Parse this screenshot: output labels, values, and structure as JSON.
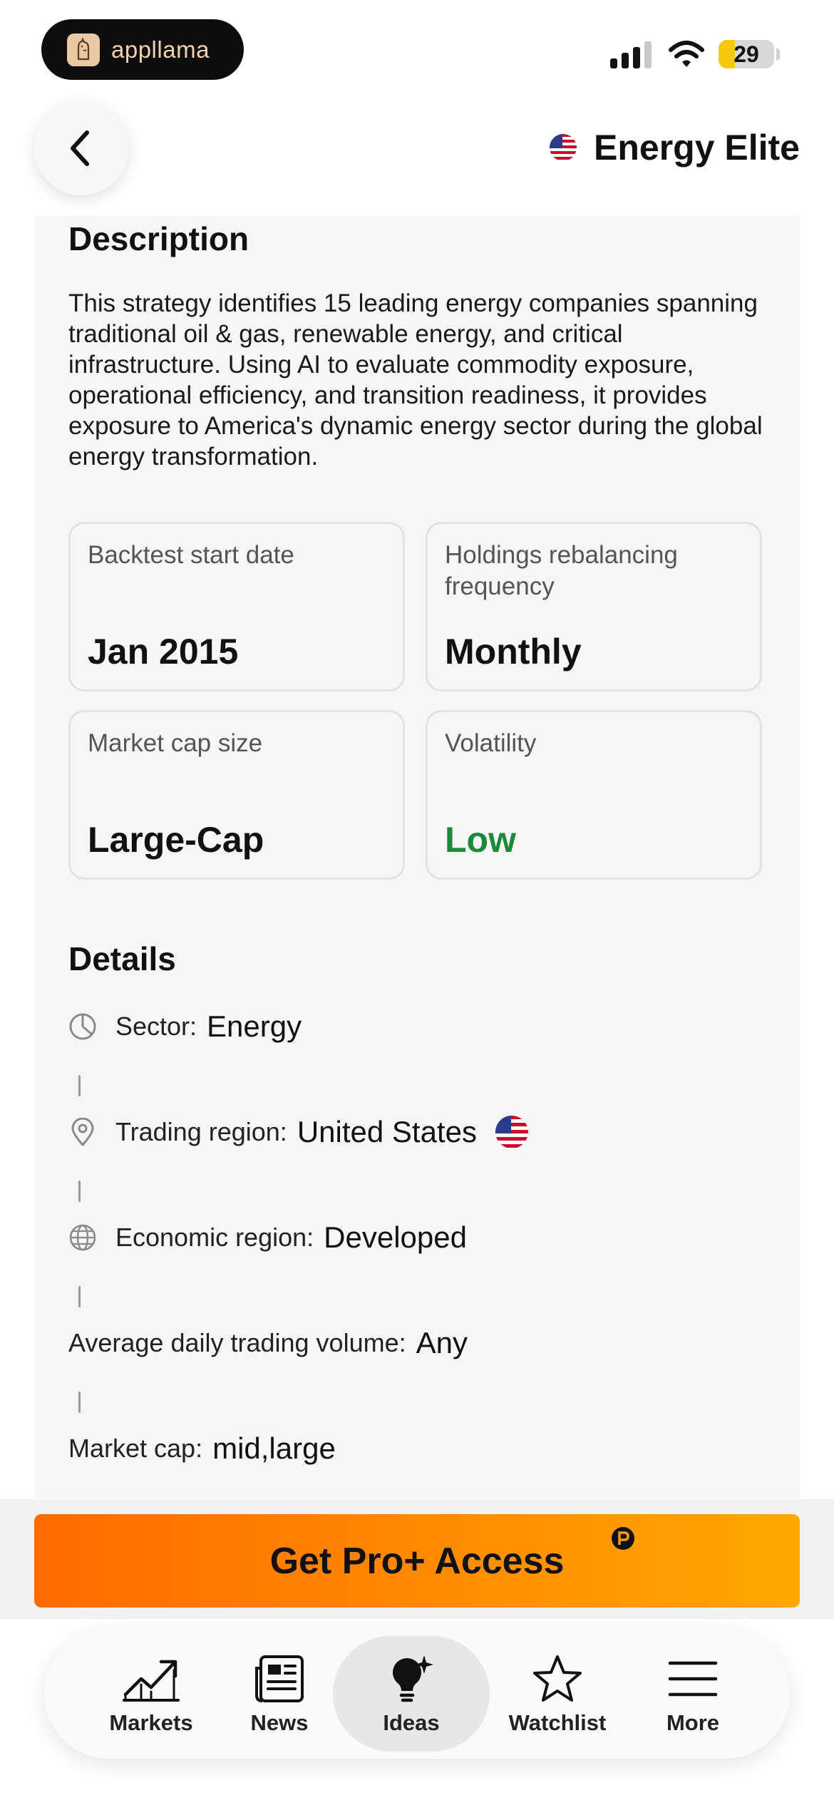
{
  "status_bar": {
    "app_name": "appllama",
    "battery_level": "29"
  },
  "header": {
    "title": "Energy Elite",
    "flag_icon": "us-flag-icon",
    "back_icon": "chevron-left-icon"
  },
  "description": {
    "heading": "Description",
    "text": "This strategy identifies 15 leading energy companies spanning traditional oil & gas, renewable energy, and critical infrastructure. Using AI to evaluate commodity exposure, operational efficiency, and transition readiness, it provides exposure to America's dynamic energy sector during the global energy transformation."
  },
  "stats": [
    {
      "label": "Backtest start date",
      "value": "Jan 2015"
    },
    {
      "label": "Holdings rebalancing frequency",
      "value": "Monthly"
    },
    {
      "label": "Market cap size",
      "value": "Large-Cap"
    },
    {
      "label": "Volatility",
      "value": "Low",
      "value_color": "#1c8a3a"
    }
  ],
  "details": {
    "heading": "Details",
    "items": [
      {
        "label": "Sector:",
        "value": "Energy",
        "icon": "pie-chart-icon"
      },
      {
        "label": "Trading region:",
        "value": "United States",
        "icon": "location-pin-icon"
      },
      {
        "label": "Economic region:",
        "value": "Developed",
        "icon": "globe-icon"
      },
      {
        "label": "Average daily trading volume:",
        "value": "Any"
      },
      {
        "label": "Market cap:",
        "value": "mid,large"
      }
    ]
  },
  "cta": {
    "label": "Get Pro+ Access",
    "gradient_start": "#ff6a00",
    "gradient_end": "#ffa800"
  },
  "tab_bar": {
    "tabs": [
      {
        "label": "Markets",
        "icon": "chart-trend-icon"
      },
      {
        "label": "News",
        "icon": "newspaper-icon"
      },
      {
        "label": "Ideas",
        "icon": "lightbulb-icon",
        "active": true
      },
      {
        "label": "Watchlist",
        "icon": "star-icon"
      },
      {
        "label": "More",
        "icon": "menu-icon"
      }
    ]
  }
}
